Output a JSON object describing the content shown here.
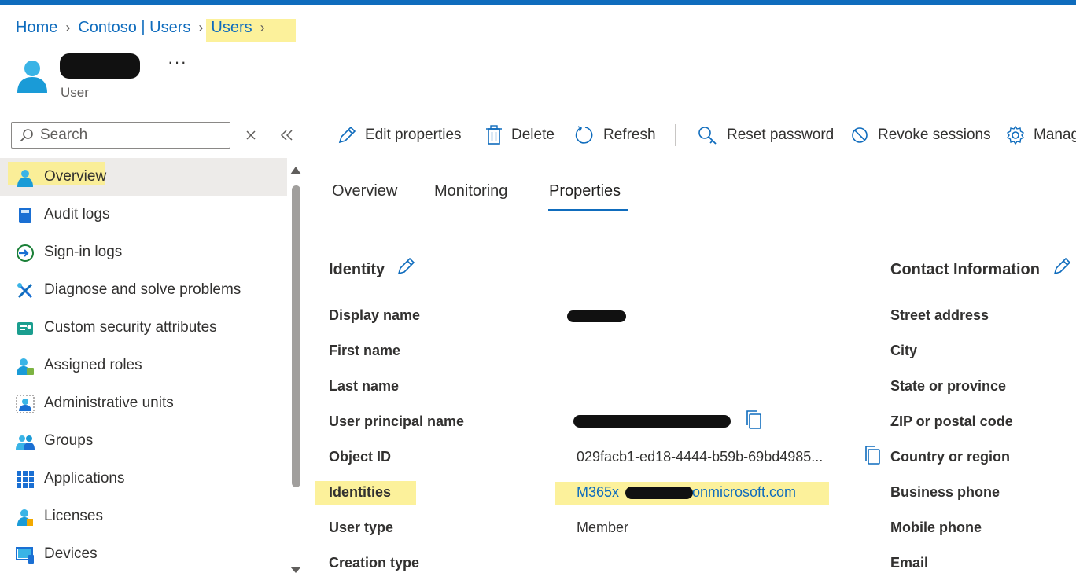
{
  "breadcrumb": {
    "home": "Home",
    "tenant_users": "Contoso | Users",
    "users": "Users"
  },
  "header": {
    "subtitle": "User",
    "more_label": "···"
  },
  "search": {
    "placeholder": "Search"
  },
  "nav": {
    "items": [
      {
        "label": "Overview",
        "icon": "user-icon",
        "active": true
      },
      {
        "label": "Audit logs",
        "icon": "book-icon"
      },
      {
        "label": "Sign-in logs",
        "icon": "sign-in-icon"
      },
      {
        "label": "Diagnose and solve problems",
        "icon": "wrench-icon"
      },
      {
        "label": "Custom security attributes",
        "icon": "security-attributes-icon"
      },
      {
        "label": "Assigned roles",
        "icon": "assigned-roles-icon"
      },
      {
        "label": "Administrative units",
        "icon": "administrative-units-icon"
      },
      {
        "label": "Groups",
        "icon": "groups-icon"
      },
      {
        "label": "Applications",
        "icon": "applications-grid-icon"
      },
      {
        "label": "Licenses",
        "icon": "licenses-icon"
      },
      {
        "label": "Devices",
        "icon": "devices-icon"
      }
    ]
  },
  "toolbar": {
    "edit": "Edit properties",
    "delete": "Delete",
    "refresh": "Refresh",
    "reset_password": "Reset password",
    "revoke_sessions": "Revoke sessions",
    "manage": "Manag"
  },
  "tabs": [
    {
      "label": "Overview"
    },
    {
      "label": "Monitoring"
    },
    {
      "label": "Properties",
      "active": true
    }
  ],
  "identity": {
    "title": "Identity",
    "rows": [
      {
        "label": "Display name",
        "value": ""
      },
      {
        "label": "First name",
        "value": ""
      },
      {
        "label": "Last name",
        "value": ""
      },
      {
        "label": "User principal name",
        "value": ""
      },
      {
        "label": "Object ID",
        "value": "029facb1-ed18-4444-b59b-69bd4985..."
      },
      {
        "label": "Identities",
        "value": "M365x",
        "value_suffix": "onmicrosoft.com"
      },
      {
        "label": "User type",
        "value": "Member"
      },
      {
        "label": "Creation type",
        "value": ""
      }
    ]
  },
  "contact": {
    "title": "Contact Information",
    "rows": [
      {
        "label": "Street address"
      },
      {
        "label": "City"
      },
      {
        "label": "State or province"
      },
      {
        "label": "ZIP or postal code"
      },
      {
        "label": "Country or region"
      },
      {
        "label": "Business phone"
      },
      {
        "label": "Mobile phone"
      },
      {
        "label": "Email"
      }
    ]
  },
  "colors": {
    "accent": "#0f6cbd",
    "highlight": "#fbef8a",
    "nav_active": "#edebe9"
  }
}
